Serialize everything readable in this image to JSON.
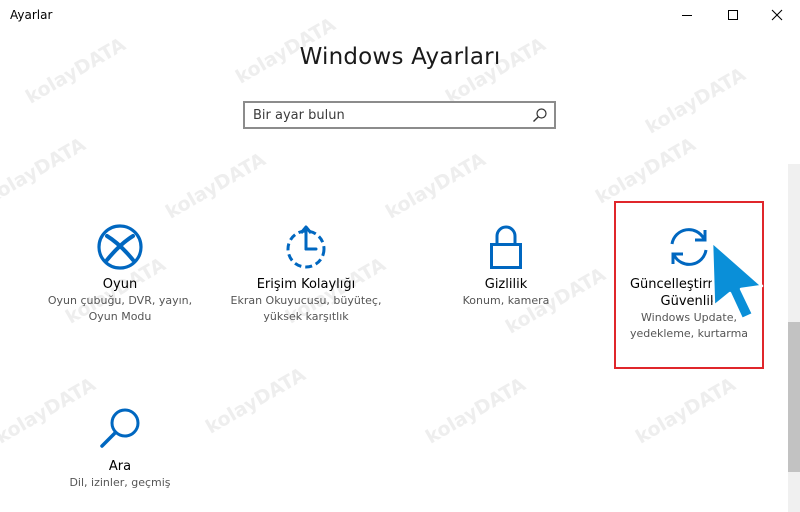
{
  "window": {
    "title": "Ayarlar"
  },
  "controls": {
    "minimize": "minimize-icon",
    "maximize": "maximize-icon",
    "close": "close-icon"
  },
  "header": {
    "title": "Windows Ayarları"
  },
  "search": {
    "placeholder": "Bir ayar bulun"
  },
  "tiles": [
    {
      "name": "Oyun",
      "desc1": "Oyun çubuğu, DVR, yayın,",
      "desc2": "Oyun Modu",
      "icon": "xbox-icon"
    },
    {
      "name": "Erişim Kolaylığı",
      "desc1": "Ekran Okuyucusu, büyüteç,",
      "desc2": "yüksek karşıtlık",
      "icon": "ease-of-access-icon"
    },
    {
      "name": "Gizlilik",
      "desc1": "Konum, kamera",
      "desc2": "",
      "icon": "lock-icon"
    },
    {
      "name1": "Güncelleştirme ve",
      "name2": "Güvenlik",
      "desc1": "Windows Update,",
      "desc2": "yedekleme, kurtarma",
      "icon": "sync-icon"
    },
    {
      "name": "Ara",
      "desc1": "Dil, izinler, geçmiş",
      "desc2": "",
      "icon": "magnifier-icon"
    }
  ],
  "watermark": {
    "text": "kolayDATA"
  },
  "colors": {
    "accent": "#0067c0",
    "highlight": "#e0262b",
    "cursor": "#0a8fd8"
  }
}
